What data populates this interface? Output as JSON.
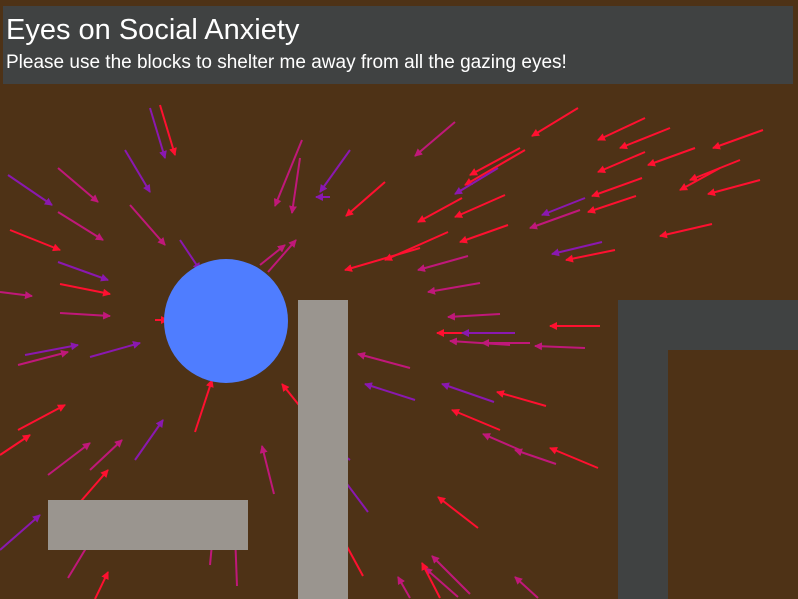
{
  "header": {
    "title": "Eyes on Social Anxiety",
    "instruction": "Please use the blocks to shelter me away from all the gazing eyes!"
  },
  "colors": {
    "background": "#4e3216",
    "banner": "#404242",
    "player": "#4f7dff",
    "block": "#9a958f",
    "wall": "#404242",
    "gaze_red": "#ff1030",
    "gaze_magenta": "#c0187a",
    "gaze_purple": "#8a18b0"
  },
  "player": {
    "shape": "circle",
    "state": "being gazed at"
  },
  "blocks": [
    {
      "id": "block-vertical",
      "orientation": "vertical"
    },
    {
      "id": "block-horizontal",
      "orientation": "horizontal"
    }
  ],
  "walls": [
    "L-shaped wall (right side)"
  ],
  "eyes": {
    "icon": "gaze-arrow-icon",
    "target": "player"
  }
}
